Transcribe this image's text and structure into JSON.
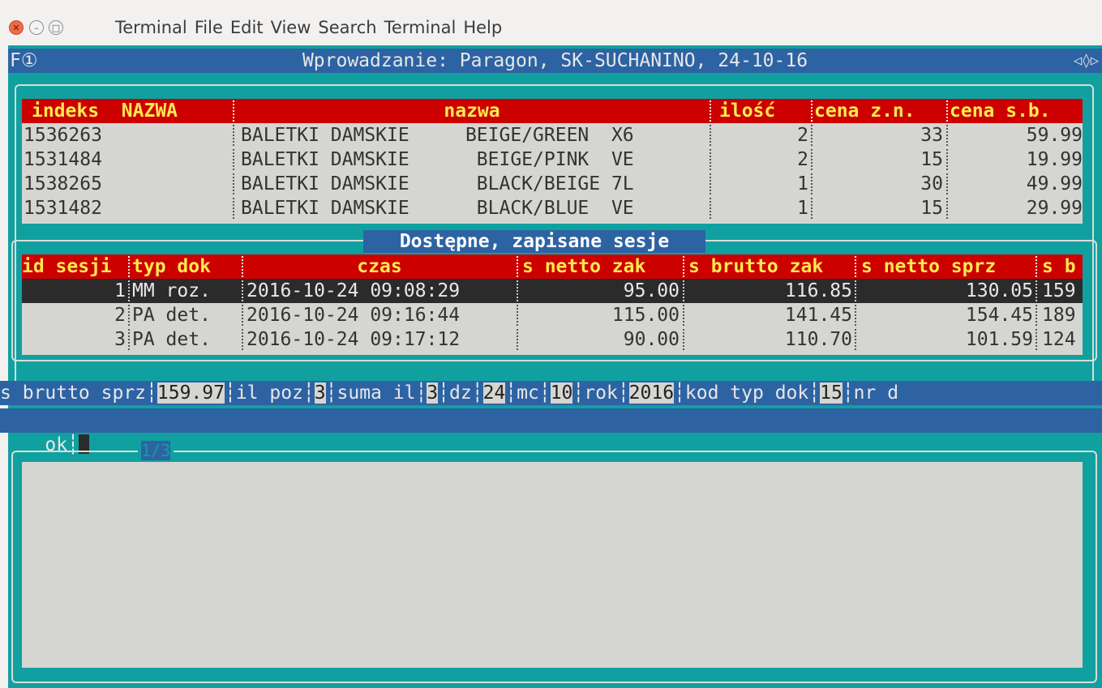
{
  "window": {
    "menu": [
      "Terminal",
      "File",
      "Edit",
      "View",
      "Search",
      "Terminal",
      "Help"
    ]
  },
  "terminal": {
    "f1": "F①",
    "title": "Wprowadzanie: Paragon, SK-SUCHANINO, 24-10-16",
    "arrows": "◁◊▷"
  },
  "items": {
    "headers": [
      "indeks  NAZWA",
      "nazwa",
      "ilość",
      "cena z.n.",
      "cena s.b."
    ],
    "rows": [
      [
        "1536263",
        "BALETKI DAMSKIE     BEIGE/GREEN  X6",
        "2",
        "33",
        "59.99"
      ],
      [
        "1531484",
        "BALETKI DAMSKIE      BEIGE/PINK  VE",
        "2",
        "15",
        "19.99"
      ],
      [
        "1538265",
        "BALETKI DAMSKIE      BLACK/BEIGE 7L",
        "1",
        "30",
        "49.99"
      ],
      [
        "1531482",
        "BALETKI DAMSKIE      BLACK/BLUE  VE",
        "1",
        "15",
        "29.99"
      ]
    ]
  },
  "sessions": {
    "title": "Dostępne, zapisane sesje",
    "headers": [
      "id sesji",
      "typ dok",
      "czas",
      "s netto zak",
      "s brutto zak",
      "s netto sprz",
      "s b"
    ],
    "rows": [
      [
        "1",
        "MM roz.",
        "2016-10-24 09:08:29",
        "95.00",
        "116.85",
        "130.05",
        "159"
      ],
      [
        "2",
        "PA det.",
        "2016-10-24 09:16:44",
        "115.00",
        "141.45",
        "154.45",
        "189"
      ],
      [
        "3",
        "PA det.",
        "2016-10-24 09:17:12",
        "90.00",
        "110.70",
        "101.59",
        "124"
      ]
    ],
    "selected_index": 0
  },
  "details": {
    "line1": [
      {
        "label": "s brutto sprz",
        "value": "159.97"
      },
      {
        "label": "il poz",
        "value": "3"
      },
      {
        "label": "suma il",
        "value": "3"
      },
      {
        "label": "dz",
        "value": "24"
      },
      {
        "label": "mc",
        "value": "10"
      },
      {
        "label": "rok",
        "value": "2016"
      },
      {
        "label": "kod typ dok",
        "value": "15"
      }
    ],
    "line1_tail": "nr d",
    "line2": "ok",
    "pager": "1/3"
  },
  "colors": {
    "terminal_bg": "#11a0a0",
    "title_bg": "#2d63a3",
    "header_bg": "#cd0000",
    "header_fg": "#fce94f",
    "panel_bg": "#d5d5d1",
    "selected_bg": "#2b2b2b"
  }
}
